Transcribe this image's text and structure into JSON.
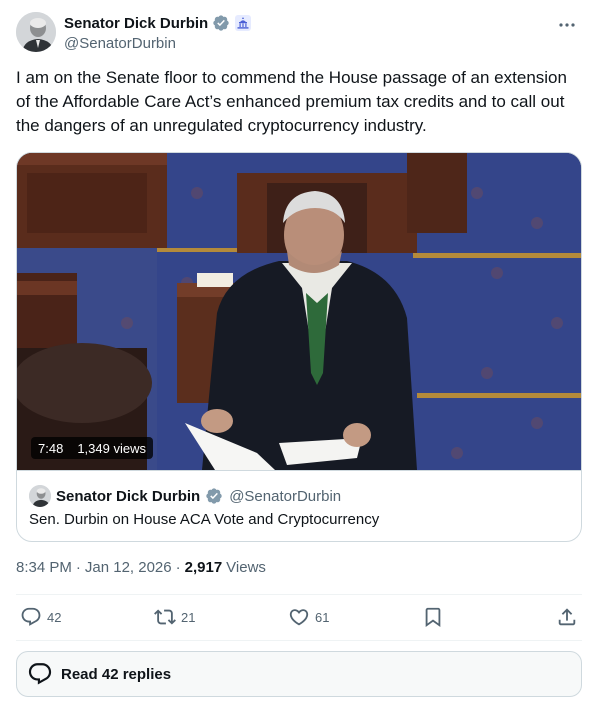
{
  "author": {
    "display_name": "Senator Dick Durbin",
    "handle": "@SenatorDurbin",
    "verified_icon": "verified-badge-grey",
    "affiliation_icon": "capitol-icon"
  },
  "tweet": {
    "text": "I am on the Senate floor to commend the House passage of an extension of the Affordable Care Act’s enhanced premium tax credits and to call out the dangers of an unregulated cryptocurrency industry."
  },
  "video": {
    "duration": "7:48",
    "views": "1,349 views"
  },
  "quote": {
    "display_name": "Senator Dick Durbin",
    "handle": "@SenatorDurbin",
    "text": "Sen. Durbin on House ACA Vote and Cryptocurrency"
  },
  "meta": {
    "time": "8:34 PM",
    "separator1": "·",
    "date": "Jan 12, 2026",
    "separator2": "·",
    "views_count": "2,917",
    "views_label": "Views"
  },
  "actions": {
    "replies": "42",
    "reposts": "21",
    "likes": "61"
  },
  "read_replies": {
    "label": "Read 42 replies"
  },
  "colors": {
    "text": "#0f1419",
    "secondary": "#536471",
    "border": "#cfd9de",
    "verified_grey": "#829aab",
    "capitol_blue": "#4a5fd6"
  }
}
